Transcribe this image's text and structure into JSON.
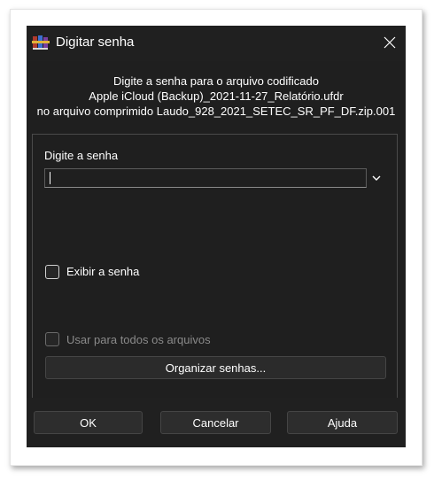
{
  "window": {
    "title": "Digitar senha",
    "close_icon": "close-icon",
    "app_icon": "winrar-books-icon"
  },
  "description": {
    "line1": "Digite a senha para o arquivo codificado",
    "line2": "Apple iCloud (Backup)_2021-11-27_Relatório.ufdr",
    "line3": "no arquivo comprimido Laudo_928_2021_SETEC_SR_PF_DF.zip.001"
  },
  "password": {
    "label": "Digite a senha",
    "value": "",
    "dropdown_icon": "chevron-down-icon"
  },
  "show_password": {
    "label": "Exibir a senha",
    "checked": false
  },
  "use_for_all": {
    "label": "Usar para todos os arquivos",
    "checked": false,
    "enabled": false
  },
  "organize_button": "Organizar senhas...",
  "footer": {
    "ok": "OK",
    "cancel": "Cancelar",
    "help": "Ajuda"
  },
  "colors": {
    "dialog_bg": "#1f1f1f",
    "button_bg": "#2d2d2d",
    "text": "#ffffff",
    "disabled_text": "#8a8a8a"
  }
}
